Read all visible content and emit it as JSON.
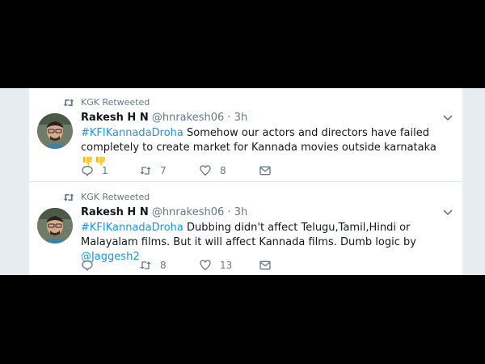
{
  "colors": {
    "link": "#1b95e0",
    "muted": "#657786",
    "text": "#14171a"
  },
  "tweets": [
    {
      "retweeted_by": "KGK Retweeted",
      "name": "Rakesh H N",
      "handle": "@hnrakesh06",
      "time": "3h",
      "hashtag": "#KFIKannadaDroha",
      "body": "Somehow our actors and directors have failed completely to create market for Kannada movies outside karnataka",
      "mention": "",
      "emojis": [
        "thumbs-down",
        "thumbs-down"
      ],
      "replies": "1",
      "retweets": "7",
      "likes": "8"
    },
    {
      "retweeted_by": "KGK Retweeted",
      "name": "Rakesh H N",
      "handle": "@hnrakesh06",
      "time": "3h",
      "hashtag": "#KFIKannadaDroha",
      "body": "Dubbing didn't affect Telugu,Tamil,Hindi or Malayalam films. But it will affect Kannada films. Dumb logic by",
      "mention": "@Jaggesh2",
      "emojis": [],
      "replies": "",
      "retweets": "8",
      "likes": "13"
    }
  ],
  "icons": {
    "retweeted": "retweet-icon",
    "menu": "chevron-down-icon",
    "reply": "reply-icon",
    "retweet": "retweet-icon",
    "like": "heart-icon",
    "dm": "envelope-icon"
  },
  "separator": "·"
}
